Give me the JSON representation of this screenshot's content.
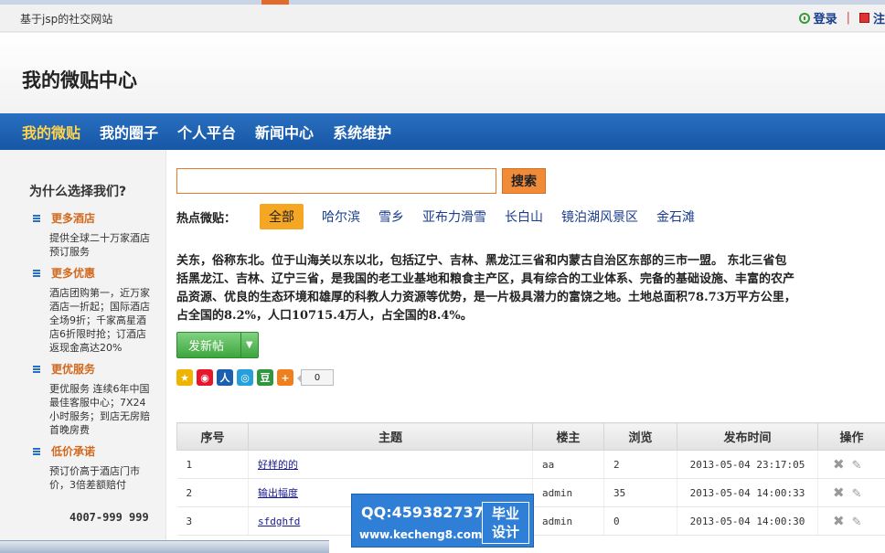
{
  "top_bar": {
    "site_name": "基于jsp的社交网站",
    "login_label": "登录",
    "register_label": "注"
  },
  "header": {
    "title": "我的微贴中心"
  },
  "nav": {
    "items": [
      {
        "label": "我的微贴",
        "active": true
      },
      {
        "label": "我的圈子"
      },
      {
        "label": "个人平台"
      },
      {
        "label": "新闻中心"
      },
      {
        "label": "系统维护"
      }
    ]
  },
  "sidebar": {
    "title": "为什么选择我们?",
    "sections": [
      {
        "head": "更多酒店",
        "body": "提供全球二十万家酒店预订服务"
      },
      {
        "head": "更多优惠",
        "body": "酒店团购第一，近万家酒店一折起；国际酒店全场9折；千家高星酒店6折限时抢；订酒店返现金高达20%"
      },
      {
        "head": "更优服务",
        "body": "更优服务 连续6年中国最佳客服中心；7X24小时服务；到店无房赔首晚房费"
      },
      {
        "head": "低价承诺",
        "body": "预订价高于酒店门市价，3倍差额赔付"
      }
    ],
    "phone": "4007-999 999"
  },
  "search": {
    "placeholder": "",
    "button_label": "搜索"
  },
  "hot": {
    "label": "热点微贴：",
    "tags": [
      "全部",
      "哈尔滨",
      "雪乡",
      "亚布力滑雪",
      "长白山",
      "镜泊湖风景区",
      "金石滩"
    ]
  },
  "intro": {
    "lines": [
      "关东，俗称东北。位于山海关以东以北，包括辽宁、吉林、黑龙江三省和内蒙古自治区东部的三市一盟。 东北三省包",
      "括黑龙江、吉林、辽宁三省，是我国的老工业基地和粮食主产区，具有综合的工业体系、完备的基础设施、丰富的农产",
      "品资源、优良的生态环境和雄厚的科教人力资源等优势，是一片极具潜力的富饶之地。土地总面积78.73万平方公里，",
      "占全国的8.2%，人口10715.4万人，占全国的8.4%。"
    ]
  },
  "post_button": {
    "label": "发新帖"
  },
  "share": {
    "icons": [
      {
        "name": "qzone-icon",
        "glyph": "★",
        "color": "#f0b400"
      },
      {
        "name": "weibo-icon",
        "glyph": "◉",
        "color": "#e6162d"
      },
      {
        "name": "renren-icon",
        "glyph": "人",
        "color": "#1b5fb1"
      },
      {
        "name": "tencent-weibo-icon",
        "glyph": "◎",
        "color": "#26a0da"
      },
      {
        "name": "douban-icon",
        "glyph": "豆",
        "color": "#2e963d"
      },
      {
        "name": "more-share-icon",
        "glyph": "+",
        "color": "#f07f1d"
      }
    ],
    "count": "0"
  },
  "table": {
    "headers": [
      "序号",
      "主题",
      "楼主",
      "浏览",
      "发布时间",
      "操作"
    ],
    "rows": [
      {
        "no": "1",
        "subject": "好样的的",
        "author": "aa",
        "views": "2",
        "time": "2013-05-04 23:17:05"
      },
      {
        "no": "2",
        "subject": "输出幅度",
        "author": "admin",
        "views": "35",
        "time": "2013-05-04 14:00:33"
      },
      {
        "no": "3",
        "subject": "sfdghfd",
        "author": "admin",
        "views": "0",
        "time": "2013-05-04 14:00:30"
      }
    ]
  },
  "watermark": {
    "qq": "QQ:459382737",
    "site": "www.kecheng8.com",
    "badge_line1": "毕业",
    "badge_line2": "设计"
  }
}
